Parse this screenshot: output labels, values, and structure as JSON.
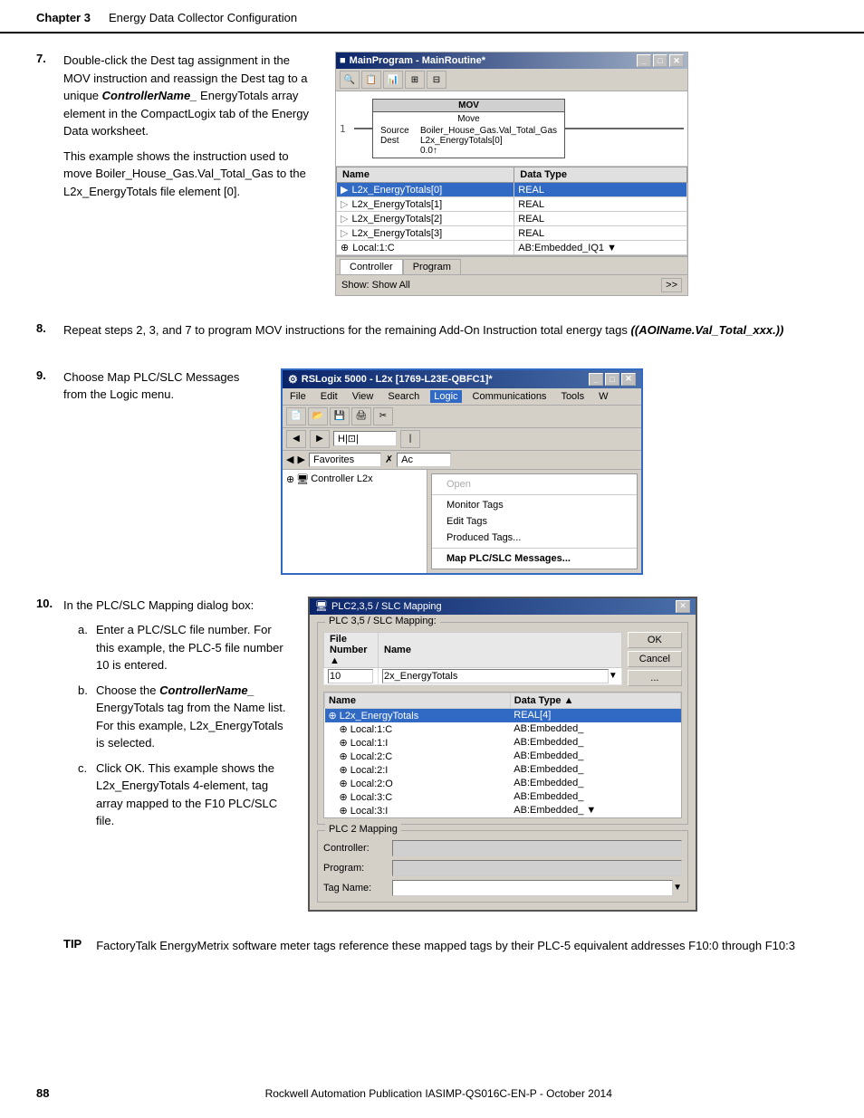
{
  "header": {
    "chapter": "Chapter 3",
    "title": "Energy Data Collector Configuration"
  },
  "step7": {
    "number": "7.",
    "instruction": "Double-click the Dest tag assignment in the MOV instruction and reassign the Dest tag to a unique",
    "italic_text": "ControllerName_",
    "instruction2": "EnergyTotals array element in the CompactLogix tab of the Energy Data worksheet.",
    "example_text": "This example shows the instruction used to move Boiler_House_Gas.Val_Total_Gas to the L2x_EnergyTotals file element [0].",
    "window_title": "MainProgram - MainRoutine*",
    "rung_number": "1",
    "mov_title": "MOV",
    "mov_move": "Move",
    "mov_source_label": "Source",
    "mov_source_value": "Boiler_House_Gas.Val_Total_Gas",
    "mov_dest_label": "Dest",
    "mov_dest_value": "L2x_EnergyTotals[0]",
    "mov_dest_value2": "0.0↑",
    "tags": [
      {
        "icon": "▶",
        "name": "L2x_EnergyTotals[0]",
        "data_type": "REAL",
        "selected": true
      },
      {
        "icon": "▷",
        "name": "L2x_EnergyTotals[1]",
        "data_type": "REAL",
        "selected": false
      },
      {
        "icon": "▷",
        "name": "L2x_EnergyTotals[2]",
        "data_type": "REAL",
        "selected": false
      },
      {
        "icon": "▷",
        "name": "L2x_EnergyTotals[3]",
        "data_type": "REAL",
        "selected": false
      },
      {
        "icon": "⊕",
        "name": "Local:1:C",
        "data_type": "AB:Embedded_IO1",
        "selected": false
      }
    ],
    "tag_col_name": "Name",
    "tag_col_type": "Data Type",
    "tab_controller": "Controller",
    "tab_program": "Program",
    "show_label": "Show: Show All",
    "scroll_more": ">>"
  },
  "step8": {
    "number": "8.",
    "text": "Repeat steps 2, 3, and 7 to program MOV instructions for the remaining Add-On Instruction total energy tags",
    "italic_text": "(AOIName.Val_Total_xxx.)"
  },
  "step9": {
    "number": "9.",
    "text": "Choose Map PLC/SLC Messages from the Logic menu.",
    "window_title": "RSLogix 5000 - L2x [1769-L23E-QBFC1]*",
    "menu_items": [
      "File",
      "Edit",
      "View",
      "Search",
      "Logic",
      "Communications",
      "Tools",
      "W"
    ],
    "active_menu": "Logic",
    "dropdown_items": [
      "Open",
      "",
      "Monitor Tags",
      "Edit Tags",
      "Produced Tags...",
      "Map PLC/SLC Messages..."
    ],
    "tree_item": "Controller L2x",
    "toolbar_icons": [
      "📄",
      "📂",
      "💾",
      "🖨",
      "✂"
    ]
  },
  "step10": {
    "number": "10.",
    "text": "In the PLC/SLC Mapping dialog box:",
    "dialog_title": "PLC2,3,5 / SLC Mapping",
    "section_title": "PLC 3,5 / SLC Mapping:",
    "col_file_number": "File Number",
    "col_name": "Name",
    "file_number": "10",
    "name_value": "2x_EnergyTotals",
    "btn_ok": "OK",
    "btn_cancel": "Cancel",
    "btn_ellipsis": "...",
    "tag_col_name": "Name",
    "tag_col_type": "Data Type",
    "tags": [
      {
        "icon": "⊕",
        "name": "L2x_EnergyTotals",
        "data_type": "REAL[4]",
        "selected": true
      },
      {
        "icon": "⊕",
        "name": "Local:1:C",
        "data_type": "AB:Embedded_",
        "selected": false
      },
      {
        "icon": "⊕",
        "name": "Local:1:I",
        "data_type": "AB:Embedded_",
        "selected": false
      },
      {
        "icon": "⊕",
        "name": "Local:2:C",
        "data_type": "AB:Embedded_",
        "selected": false
      },
      {
        "icon": "⊕",
        "name": "Local:2:I",
        "data_type": "AB:Embedded_",
        "selected": false
      },
      {
        "icon": "⊕",
        "name": "Local:2:O",
        "data_type": "AB:Embedded_",
        "selected": false
      },
      {
        "icon": "⊕",
        "name": "Local:3:C",
        "data_type": "AB:Embedded_",
        "selected": false
      },
      {
        "icon": "⊕",
        "name": "Local:3:I",
        "data_type": "AB:Embedded_",
        "selected": false
      }
    ],
    "section2_title": "PLC 2 Mapping",
    "controller_label": "Controller:",
    "program_label": "Program:",
    "tag_name_label": "Tag Name:",
    "sub_steps": [
      {
        "letter": "a.",
        "text": "Enter a PLC/SLC file number. For this example, the PLC-5 file number 10 is entered."
      },
      {
        "letter": "b.",
        "text": "Choose the",
        "italic": "ControllerName_",
        "text2": "EnergyTotals tag from the Name list. For this example, L2x_EnergyTotals is selected."
      },
      {
        "letter": "c.",
        "text": "Click OK. This example shows the L2x_EnergyTotals 4-element, tag array mapped to the F10 PLC/SLC file."
      }
    ]
  },
  "tip": {
    "label": "TIP",
    "text": "FactoryTalk EnergyMetrix software meter tags reference these mapped tags by their PLC-5 equivalent addresses F10:0 through F10:3"
  },
  "footer": {
    "page_number": "88",
    "center_text": "Rockwell Automation Publication IASIMP-QS016C-EN-P - October 2014"
  }
}
